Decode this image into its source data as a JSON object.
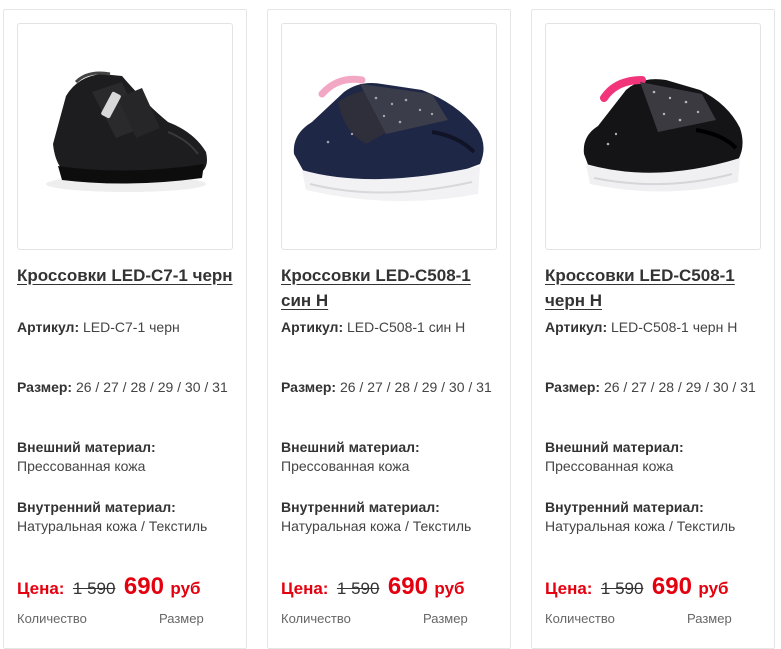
{
  "products": [
    {
      "title": "Кроссовки LED-C7-1 черн",
      "article_label": "Артикул:",
      "article": "LED-C7-1 черн",
      "size_label": "Размер:",
      "sizes": "26 / 27 / 28 / 29 / 30 / 31",
      "outer_label": "Внешний материал:",
      "outer": "Прессованная кожа",
      "inner_label": "Внутренний материал:",
      "inner": "Натуральная кожа / Текстиль",
      "price_label": "Цена:",
      "price_old": "1 590",
      "price_new": "690",
      "currency": "руб",
      "qty_label": "Количество",
      "size_col_label": "Размер"
    },
    {
      "title": "Кроссовки LED-C508-1 син Н",
      "article_label": "Артикул:",
      "article": "LED-C508-1 син Н",
      "size_label": "Размер:",
      "sizes": "26 / 27 / 28 / 29 / 30 / 31",
      "outer_label": "Внешний материал:",
      "outer": "Прессованная кожа",
      "inner_label": "Внутренний материал:",
      "inner": "Натуральная кожа / Текстиль",
      "price_label": "Цена:",
      "price_old": "1 590",
      "price_new": "690",
      "currency": "руб",
      "qty_label": "Количество",
      "size_col_label": "Размер"
    },
    {
      "title": "Кроссовки LED-C508-1 черн Н",
      "article_label": "Артикул:",
      "article": "LED-C508-1 черн Н",
      "size_label": "Размер:",
      "sizes": "26 / 27 / 28 / 29 / 30 / 31",
      "outer_label": "Внешний материал:",
      "outer": "Прессованная кожа",
      "inner_label": "Внутренний материал:",
      "inner": "Натуральная кожа / Текстиль",
      "price_label": "Цена:",
      "price_old": "1 590",
      "price_new": "690",
      "currency": "руб",
      "qty_label": "Количество",
      "size_col_label": "Размер"
    }
  ],
  "colors": {
    "price_red": "#e3000f",
    "text": "#333333",
    "border": "#e6e6e6"
  },
  "icons": [
    "sneaker-photo-black",
    "sneaker-photo-navy-glitter",
    "sneaker-photo-black-glitter"
  ]
}
